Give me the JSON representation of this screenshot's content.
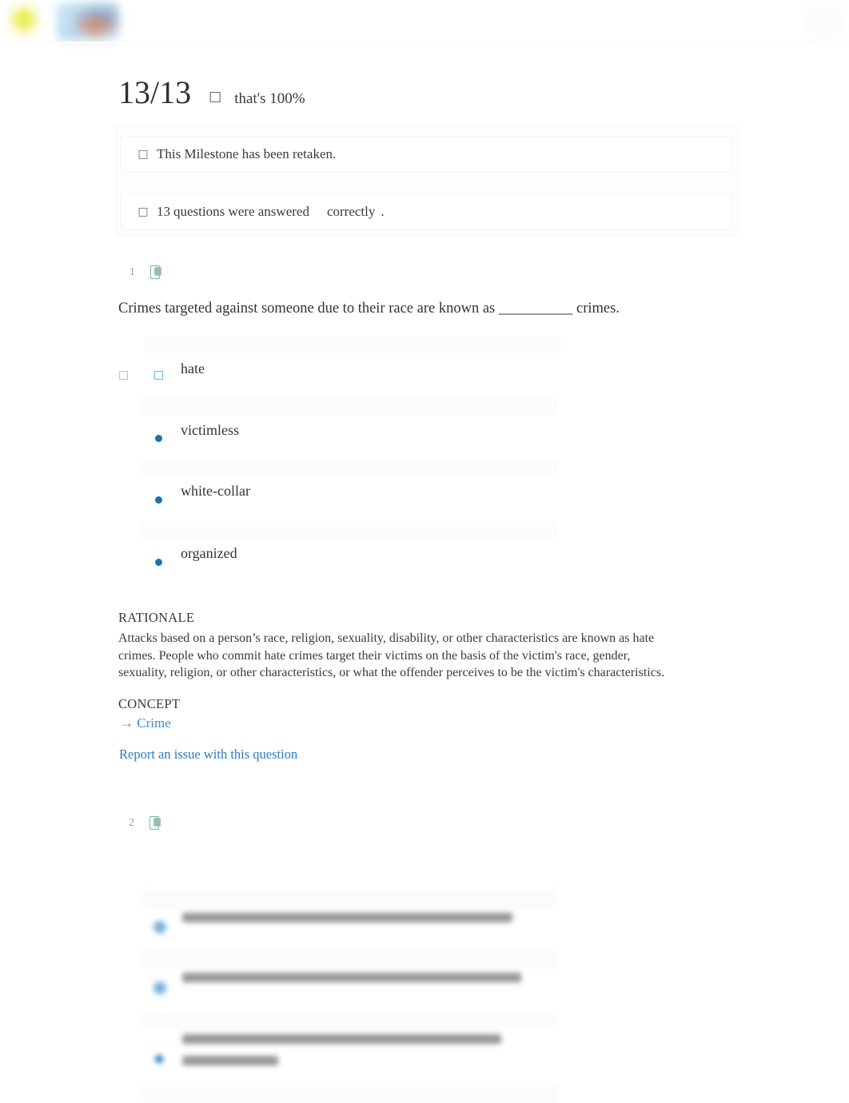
{
  "header": {
    "logo_icon": "sophia-logo-icon",
    "brand_icon": "brand-image-icon",
    "account_icon": "account-menu-icon"
  },
  "score": {
    "fraction": "13/13",
    "check_icon": "check-icon",
    "percent_text": "that's 100%"
  },
  "alerts": [
    {
      "icon": "info-icon",
      "text": "This Milestone has been retaken."
    },
    {
      "icon": "info-icon",
      "count": "13",
      "text": "questions were answered",
      "emphasis": "correctly",
      "period": "."
    }
  ],
  "questions": [
    {
      "number": "1",
      "status_icon": "correct-badge-icon",
      "prompt": "Crimes targeted against someone due to their race are known as __________ crimes.",
      "options": [
        {
          "label": "hate",
          "selected": true,
          "correct": true,
          "correct_icon": "check-icon",
          "radio_icon": "radio-selected-icon"
        },
        {
          "label": "victimless",
          "selected": false,
          "correct": false,
          "bullet_icon": "bullet-icon"
        },
        {
          "label": "white-collar",
          "selected": false,
          "correct": false,
          "bullet_icon": "bullet-icon"
        },
        {
          "label": "organized",
          "selected": false,
          "correct": false,
          "bullet_icon": "bullet-icon"
        }
      ],
      "rationale_heading": "RATIONALE",
      "rationale_text": "Attacks based on a person’s race, religion, sexuality, disability, or other characteristics are known as hate crimes. People who commit hate crimes target their victims on the basis of the victim's race, gender, sexuality, religion, or other characteristics, or what the offender perceives to be the victim's characteristics.",
      "concept_heading": "CONCEPT",
      "concept_link": "→ Crime",
      "report_link": "Report an issue with this question"
    },
    {
      "number": "2",
      "status_icon": "correct-badge-icon",
      "prompt": "",
      "options": [
        {
          "label": "",
          "bullet_icon": "bullet-icon"
        },
        {
          "label": "",
          "bullet_icon": "bullet-icon"
        },
        {
          "label": "",
          "bullet_icon": "bullet-icon"
        }
      ]
    }
  ],
  "colors": {
    "accent_blue": "#1673ba",
    "link_blue": "#2b7cc0",
    "concept_blue": "#3d90cd",
    "correct_green": "#6bbd9b",
    "text": "#3a3a3a",
    "muted": "#9c9c9c",
    "band": "#fcfcfd"
  }
}
